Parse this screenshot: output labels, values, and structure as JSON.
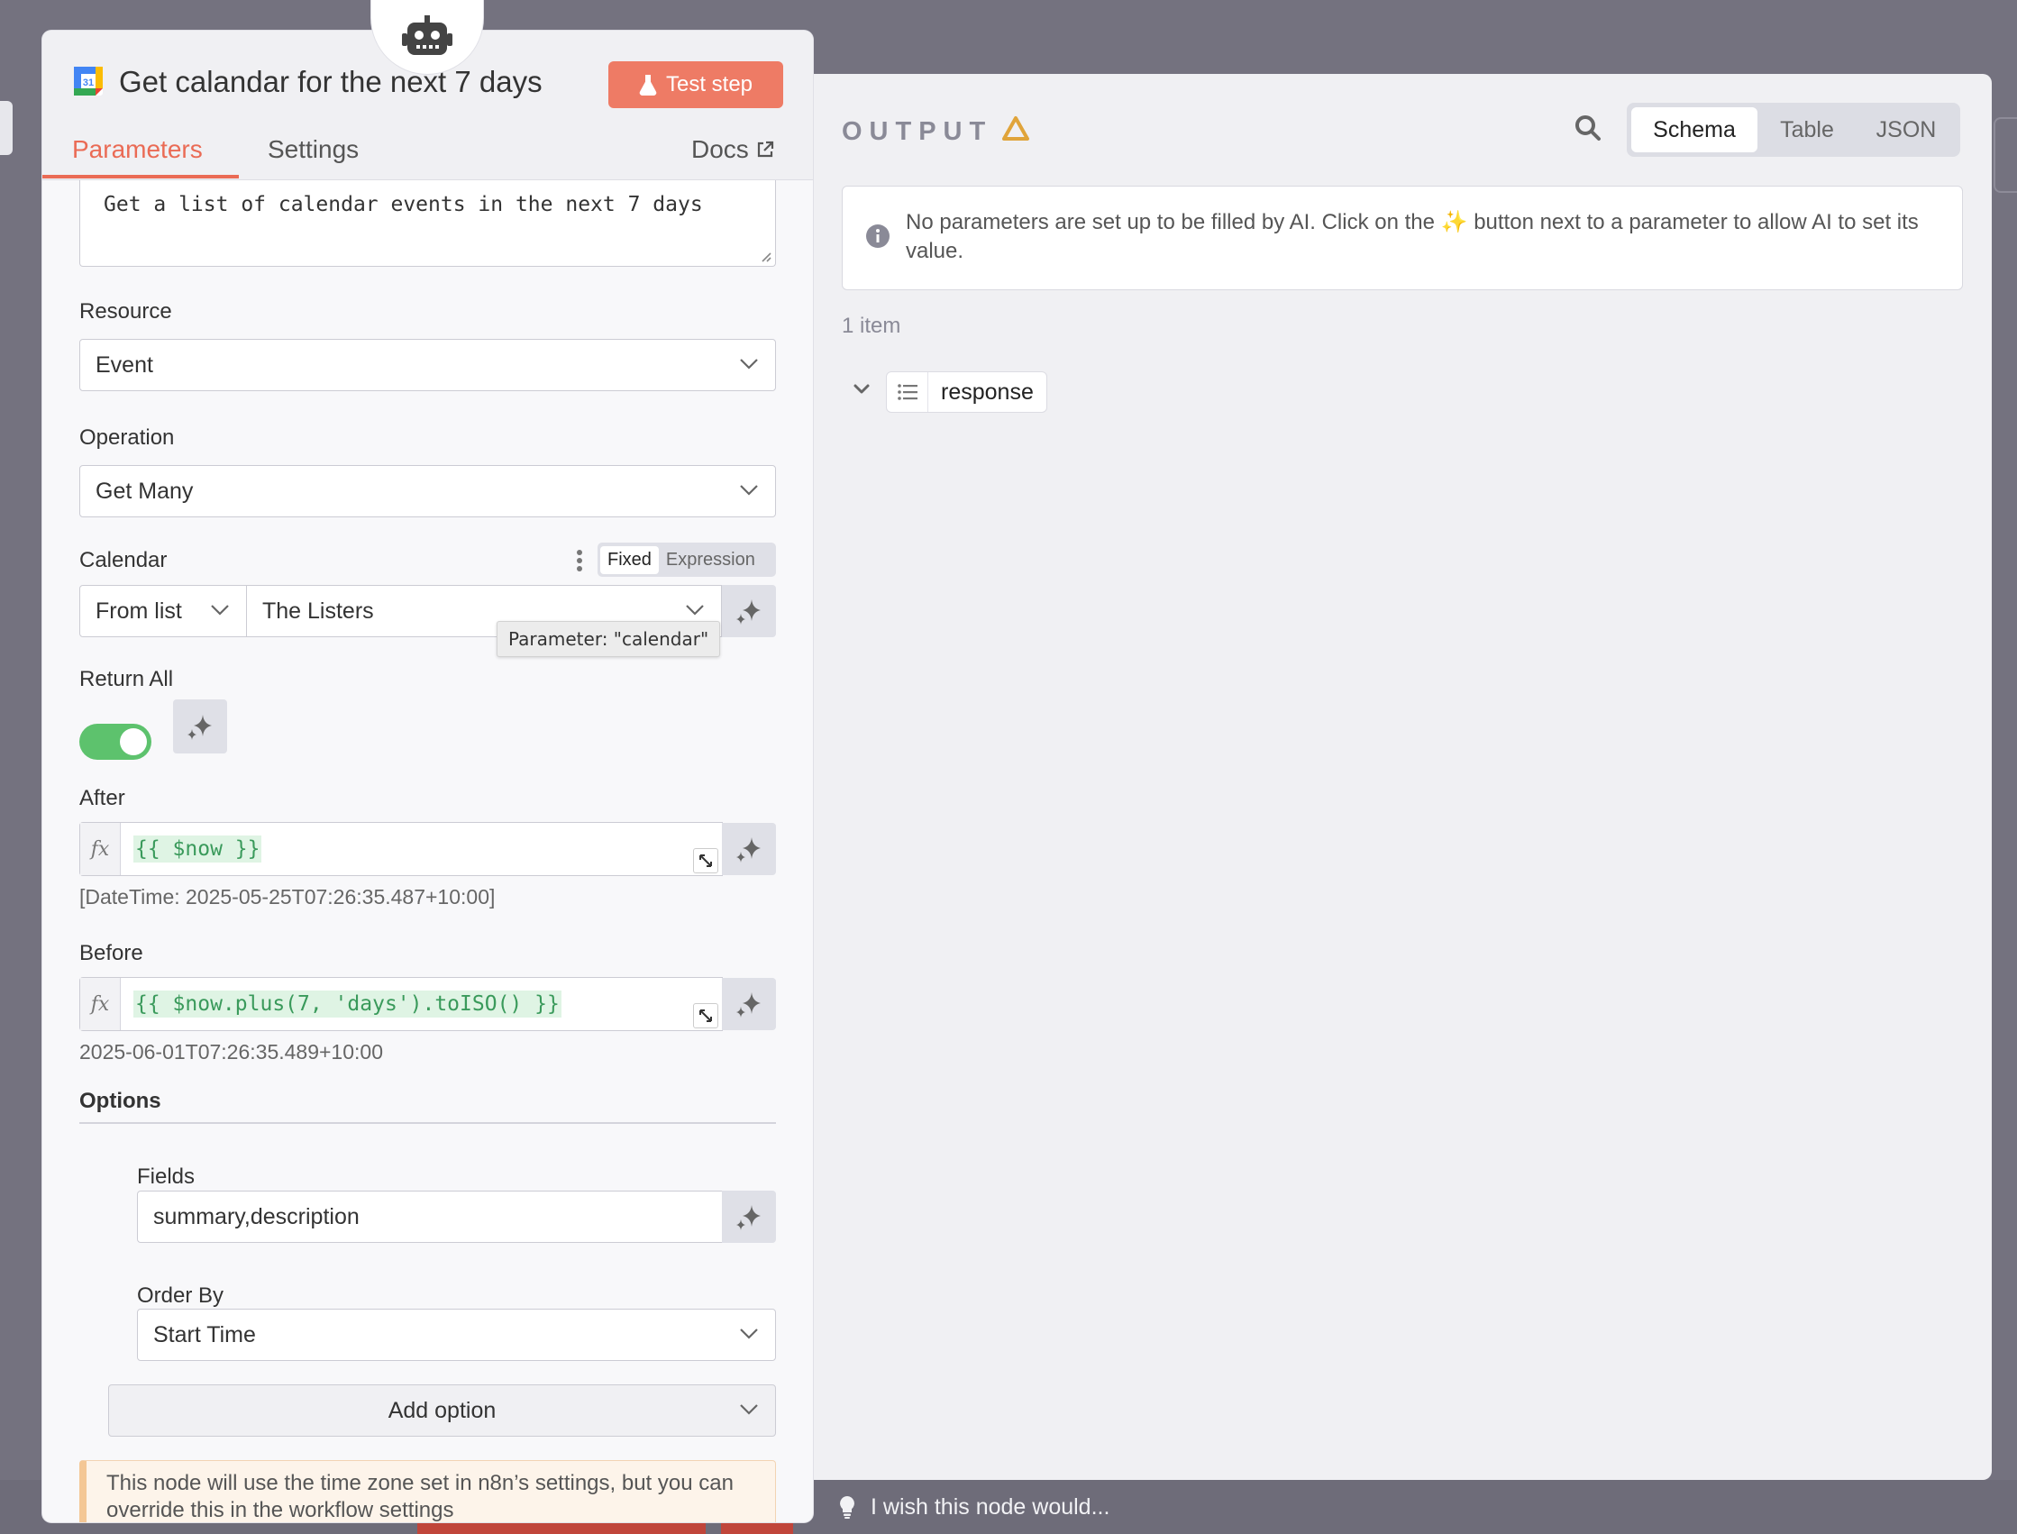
{
  "node": {
    "title": "Get calandar for the next 7 days",
    "test_step_label": "Test step"
  },
  "tabs": {
    "parameters": "Parameters",
    "settings": "Settings",
    "docs": "Docs"
  },
  "description": {
    "value": "Get a list of calendar events in the next 7 days"
  },
  "resource": {
    "label": "Resource",
    "value": "Event"
  },
  "operation": {
    "label": "Operation",
    "value": "Get Many"
  },
  "calendar": {
    "label": "Calendar",
    "mode_fixed": "Fixed",
    "mode_expression": "Expression",
    "source": "From list",
    "value": "The Listers",
    "tooltip": "Parameter: \"calendar\""
  },
  "return_all": {
    "label": "Return All",
    "enabled": true
  },
  "after": {
    "label": "After",
    "fx": "fx",
    "expression": "{{ $now }}",
    "result": "[DateTime: 2025-05-25T07:26:35.487+10:00]"
  },
  "before": {
    "label": "Before",
    "fx": "fx",
    "expression": "{{ $now.plus(7, 'days').toISO() }}",
    "result": "2025-06-01T07:26:35.489+10:00"
  },
  "options": {
    "label": "Options",
    "fields_label": "Fields",
    "fields_value": "summary,description",
    "order_by_label": "Order By",
    "order_by_value": "Start Time",
    "add_option_label": "Add option"
  },
  "notice": {
    "text": "This node will use the time zone set in n8n’s settings, but you can override this in the workflow settings"
  },
  "output": {
    "title": "OUTPUT",
    "views": [
      "Schema",
      "Table",
      "JSON"
    ],
    "active_view": "Schema",
    "info_text": "No parameters are set up to be filled by AI. Click on the ✨ button next to a parameter to allow AI to set its value.",
    "item_count": "1 item",
    "schema_field": "response"
  },
  "feedback": {
    "text": "I wish this node would..."
  },
  "colors": {
    "accent": "#ea6b55",
    "test_button": "#ee7b65",
    "toggle_on": "#5dc26d",
    "warning": "#e0a43a",
    "expression_text": "#3a9a5b"
  },
  "icons": {
    "node_badge": "robot-icon",
    "node_app": "google-calendar-icon",
    "test": "flask-icon",
    "docs": "external-link-icon",
    "ai": "sparkle-icon",
    "warning": "warning-triangle-icon",
    "search": "search-icon",
    "info": "info-icon",
    "schema_type": "list-icon",
    "feedback": "lightbulb-icon"
  }
}
